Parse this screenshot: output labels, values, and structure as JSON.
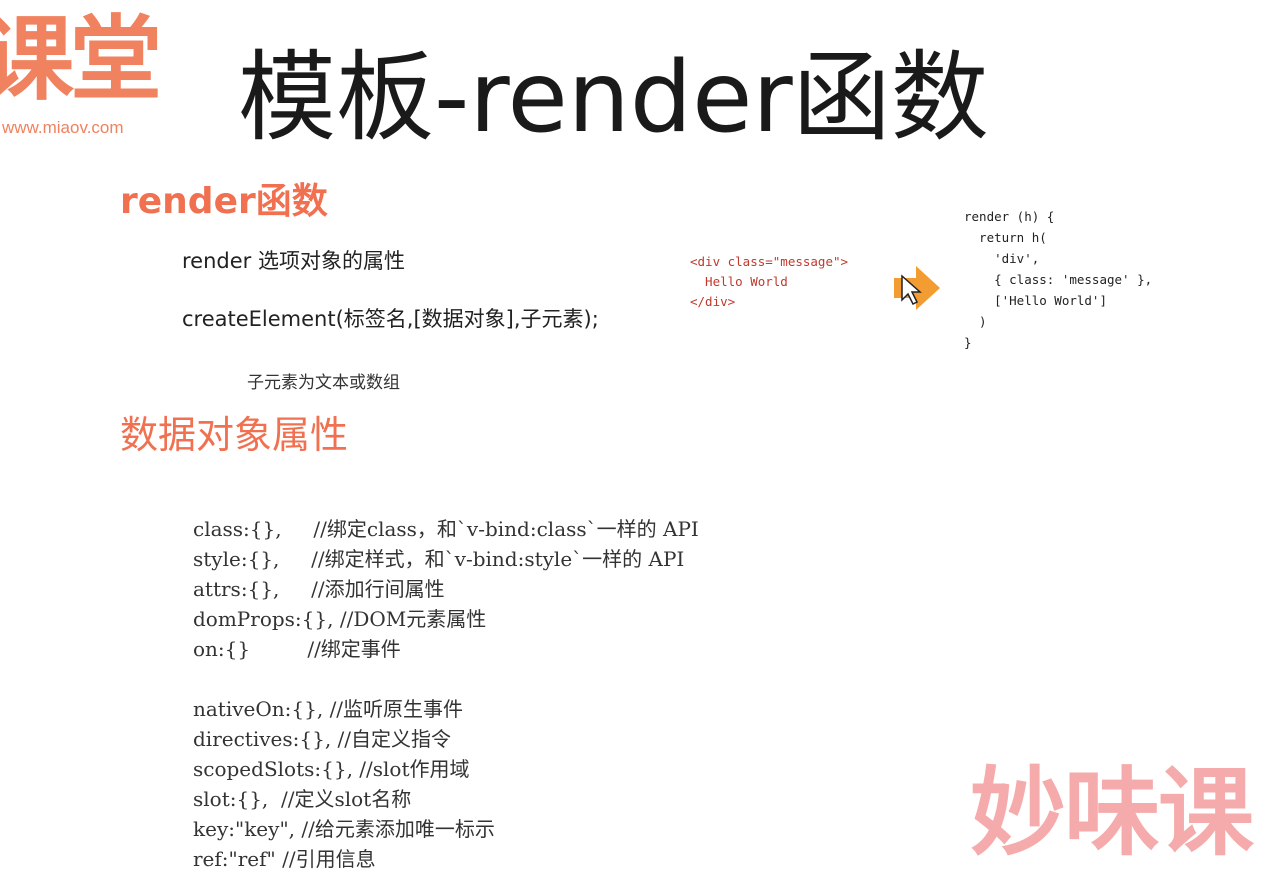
{
  "logo": {
    "brand": "课堂",
    "url": "www.miaov.com"
  },
  "title": "模板-render函数",
  "section1": {
    "heading": "render函数",
    "line1": "render 选项对象的属性",
    "line2": "createElement(标签名,[数据对象],子元素);",
    "note": "子元素为文本或数组"
  },
  "code_html": "<div class=\"message\">\n  Hello World\n</div>",
  "code_js": "render (h) {\n  return h(\n    'div',\n    { class: 'message' },\n    ['Hello World']\n  )\n}",
  "section2": {
    "heading": "数据对象属性",
    "props": [
      {
        "key": "class:{},     ",
        "comment": "//绑定class，和`v-bind:class`一样的 API"
      },
      {
        "key": "style:{},     ",
        "comment": "//绑定样式，和`v-bind:style`一样的 API"
      },
      {
        "key": "attrs:{},     ",
        "comment": "//添加行间属性"
      },
      {
        "key": "domProps:{}, ",
        "comment": "//DOM元素属性"
      },
      {
        "key": "on:{}         ",
        "comment": "//绑定事件"
      }
    ],
    "props2": [
      {
        "key": "nativeOn:{}, ",
        "comment": "//监听原生事件"
      },
      {
        "key": "directives:{}, ",
        "comment": "//自定义指令"
      },
      {
        "key": "scopedSlots:{}, ",
        "comment": "//slot作用域"
      },
      {
        "key": "slot:{},  ",
        "comment": "//定义slot名称"
      },
      {
        "key": "key:\"key\", ",
        "comment": "//给元素添加唯一标示"
      },
      {
        "key": "ref:\"ref\" ",
        "comment": "//引用信息"
      }
    ]
  },
  "watermark": "妙味课",
  "colors": {
    "accent": "#f07050",
    "logo": "#f0825f",
    "code_red": "#c0392b",
    "watermark": "#f5a3a3"
  },
  "icons": {
    "arrow": "arrow-right-icon",
    "cursor": "mouse-cursor-icon"
  }
}
